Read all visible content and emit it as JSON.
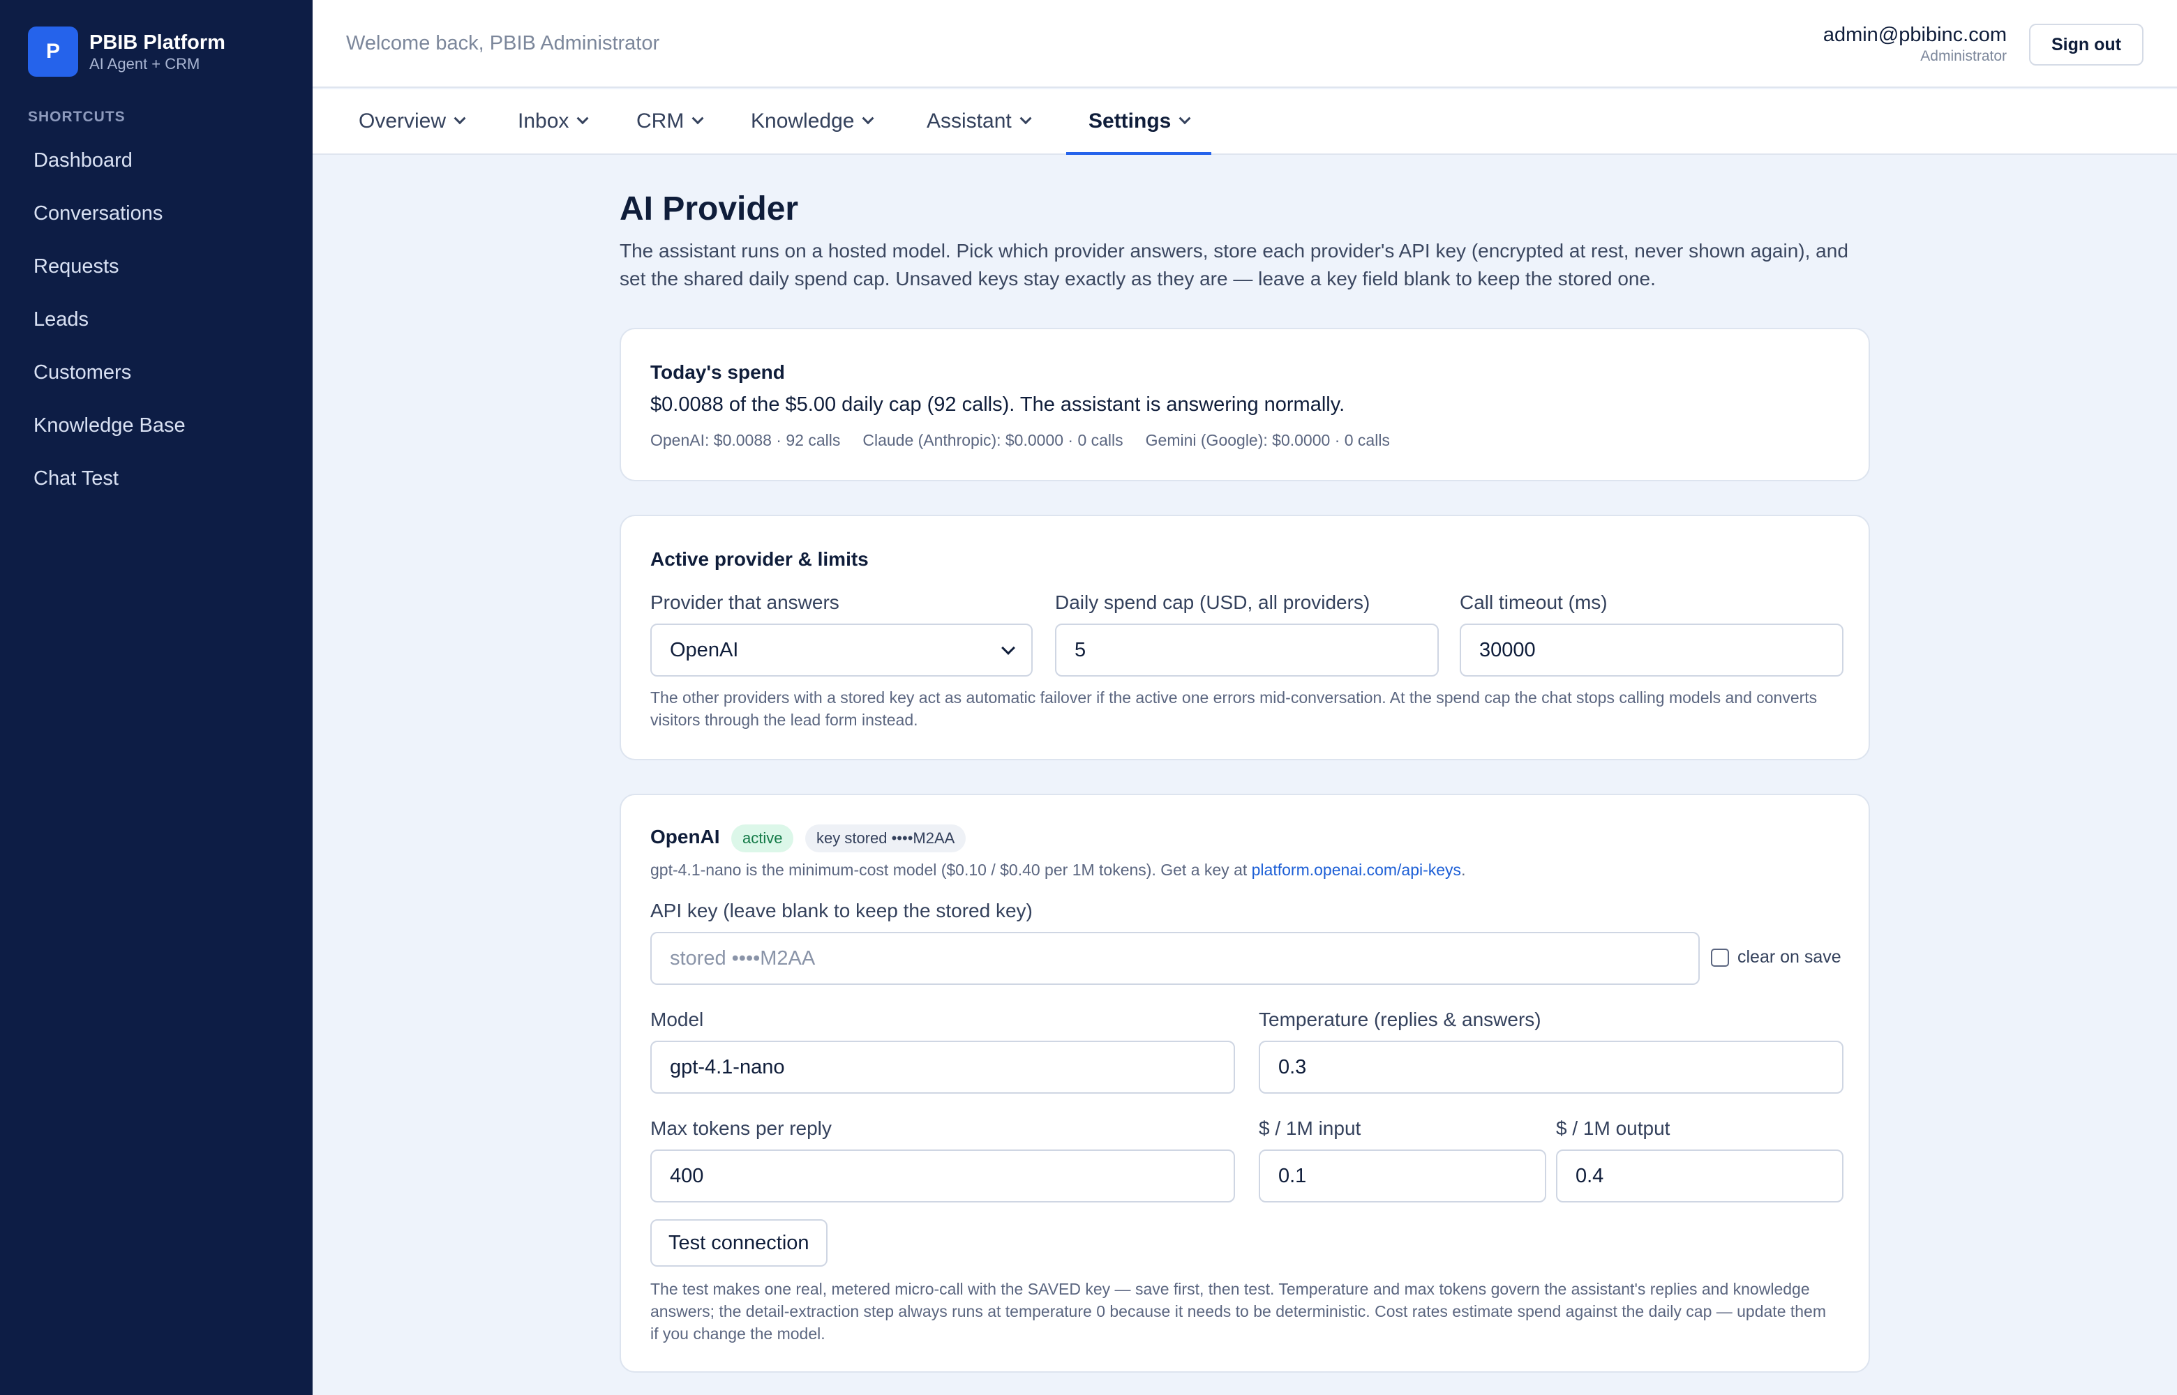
{
  "app": {
    "brand_initial": "P",
    "brand_name": "PBIB Platform",
    "brand_subtitle": "AI Agent + CRM"
  },
  "sidebar": {
    "section_label": "SHORTCUTS",
    "items": [
      {
        "label": "Dashboard"
      },
      {
        "label": "Conversations"
      },
      {
        "label": "Requests"
      },
      {
        "label": "Leads"
      },
      {
        "label": "Customers"
      },
      {
        "label": "Knowledge Base"
      },
      {
        "label": "Chat Test"
      }
    ]
  },
  "header": {
    "welcome": "Welcome back, PBIB Administrator",
    "user_email": "admin@pbibinc.com",
    "user_role": "Administrator",
    "signout_label": "Sign out"
  },
  "tabs": [
    {
      "label": "Overview",
      "active": false
    },
    {
      "label": "Inbox",
      "active": false
    },
    {
      "label": "CRM",
      "active": false
    },
    {
      "label": "Knowledge",
      "active": false
    },
    {
      "label": "Assistant",
      "active": false
    },
    {
      "label": "Settings",
      "active": true
    }
  ],
  "page": {
    "title": "AI Provider",
    "description": "The assistant runs on a hosted model. Pick which provider answers, store each provider's API key (encrypted at rest, never shown again), and set the shared daily spend cap. Unsaved keys stay exactly as they are — leave a key field blank to keep the stored one."
  },
  "spend": {
    "title": "Today's spend",
    "summary": "$0.0088 of the $5.00 daily cap (92 calls). The assistant is answering normally.",
    "breakdown": [
      "OpenAI: $0.0088 · 92 calls",
      "Claude (Anthropic): $0.0000 · 0 calls",
      "Gemini (Google): $0.0000 · 0 calls"
    ]
  },
  "limits": {
    "title": "Active provider & limits",
    "provider_label": "Provider that answers",
    "provider_value": "OpenAI",
    "cap_label": "Daily spend cap (USD, all providers)",
    "cap_value": "5",
    "timeout_label": "Call timeout (ms)",
    "timeout_value": "30000",
    "note": "The other providers with a stored key act as automatic failover if the active one errors mid-conversation. At the spend cap the chat stops calling models and converts visitors through the lead form instead."
  },
  "openai": {
    "name": "OpenAI",
    "active_badge": "active",
    "key_badge": "key stored ••••M2AA",
    "desc": "gpt-4.1-nano is the minimum-cost model ($0.10 / $0.40 per 1M tokens). Get a key at ",
    "link": "platform.openai.com/api-keys",
    "desc_end": ".",
    "api_key_label": "API key (leave blank to keep the stored key)",
    "api_key_placeholder": "stored ••••M2AA",
    "clear_label": "clear on save",
    "model_label": "Model",
    "model_value": "gpt-4.1-nano",
    "temp_label": "Temperature (replies & answers)",
    "temp_value": "0.3",
    "max_tokens_label": "Max tokens per reply",
    "max_tokens_value": "400",
    "input_cost_label": "$ / 1M input",
    "input_cost_value": "0.1",
    "output_cost_label": "$ / 1M output",
    "output_cost_value": "0.4",
    "test_label": "Test connection",
    "footnote": "The test makes one real, metered micro-call with the SAVED key — save first, then test. Temperature and max tokens govern the assistant's replies and knowledge answers; the detail-extraction step always runs at temperature 0 because it needs to be deterministic. Cost rates estimate spend against the daily cap — update them if you change the model."
  }
}
